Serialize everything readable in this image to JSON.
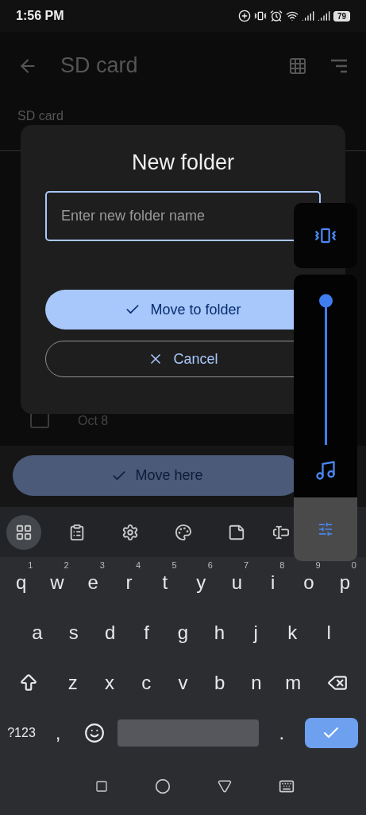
{
  "status_bar": {
    "time": "1:56 PM",
    "battery": "79"
  },
  "app_bar": {
    "title": "SD card"
  },
  "breadcrumb": "SD card",
  "file_row": {
    "date": "Oct 8",
    "checked": false
  },
  "move_here_button": "Move here",
  "dialog": {
    "title": "New folder",
    "input": {
      "placeholder": "Enter new folder name"
    },
    "buttons": [
      {
        "kind": "primary",
        "label": "Move to folder"
      },
      {
        "kind": "outline",
        "label": "Cancel"
      }
    ]
  },
  "keyboard": {
    "toolbar": [
      {
        "kind": "apps",
        "selected": true
      },
      {
        "kind": "clipboard",
        "selected": false
      },
      {
        "kind": "settings",
        "selected": false
      },
      {
        "kind": "theme",
        "selected": false
      },
      {
        "kind": "sticker",
        "selected": false
      },
      {
        "kind": "cursor",
        "selected": false
      }
    ],
    "rows": [
      [
        {
          "kind": "char",
          "label": "q",
          "hint": "1"
        },
        {
          "kind": "char",
          "label": "w",
          "hint": "2"
        },
        {
          "kind": "char",
          "label": "e",
          "hint": "3"
        },
        {
          "kind": "char",
          "label": "r",
          "hint": "4"
        },
        {
          "kind": "char",
          "label": "t",
          "hint": "5"
        },
        {
          "kind": "char",
          "label": "y",
          "hint": "6"
        },
        {
          "kind": "char",
          "label": "u",
          "hint": "7"
        },
        {
          "kind": "char",
          "label": "i",
          "hint": "8"
        },
        {
          "kind": "char",
          "label": "o",
          "hint": "9"
        },
        {
          "kind": "char",
          "label": "p",
          "hint": "0"
        }
      ],
      [
        {
          "kind": "char",
          "label": "a"
        },
        {
          "kind": "char",
          "label": "s"
        },
        {
          "kind": "char",
          "label": "d"
        },
        {
          "kind": "char",
          "label": "f"
        },
        {
          "kind": "char",
          "label": "g"
        },
        {
          "kind": "char",
          "label": "h"
        },
        {
          "kind": "char",
          "label": "j"
        },
        {
          "kind": "char",
          "label": "k"
        },
        {
          "kind": "char",
          "label": "l"
        }
      ],
      [
        {
          "kind": "shift"
        },
        {
          "kind": "char",
          "label": "z"
        },
        {
          "kind": "char",
          "label": "x"
        },
        {
          "kind": "char",
          "label": "c"
        },
        {
          "kind": "char",
          "label": "v"
        },
        {
          "kind": "char",
          "label": "b"
        },
        {
          "kind": "char",
          "label": "n"
        },
        {
          "kind": "char",
          "label": "m"
        },
        {
          "kind": "backspace"
        }
      ],
      [
        {
          "kind": "symbols",
          "label": "?123"
        },
        {
          "kind": "char",
          "label": ","
        },
        {
          "kind": "emoji"
        },
        {
          "kind": "space"
        },
        {
          "kind": "char",
          "label": "."
        },
        {
          "kind": "enter"
        }
      ]
    ]
  },
  "volume_panel": {
    "level": 1
  }
}
